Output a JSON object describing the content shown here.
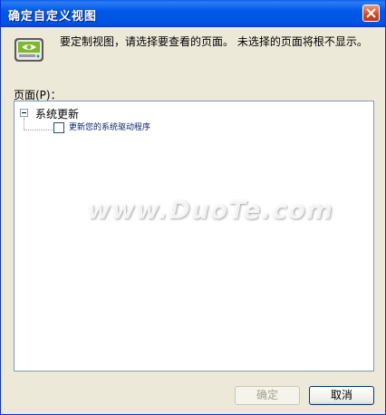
{
  "window": {
    "title": "确定自定义视图"
  },
  "header": {
    "icon": "nvidia-display-icon",
    "instruction": "要定制视图，请选择要查看的页面。 未选择的页面将根不显示。"
  },
  "list": {
    "label": "页面(P)：",
    "groups": [
      {
        "label": "系统更新",
        "expanded": true,
        "items": [
          {
            "label": "更新您的系统驱动程序",
            "checked": false
          }
        ]
      }
    ]
  },
  "buttons": {
    "ok": "确定",
    "cancel": "取消"
  },
  "watermark": {
    "center": "www.DuoTe.com"
  },
  "colors": {
    "titlebar": "#0058e8",
    "close": "#d6461f",
    "face": "#ece9d8"
  }
}
